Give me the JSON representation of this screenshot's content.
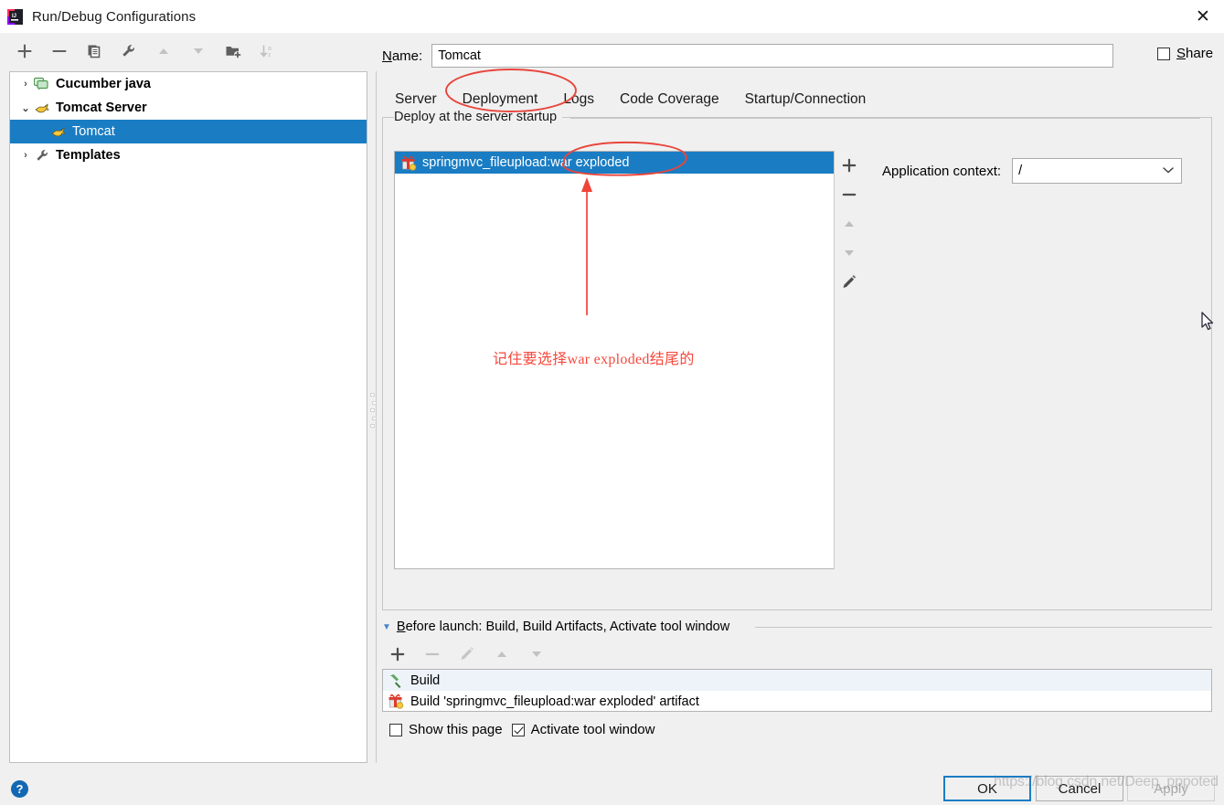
{
  "window": {
    "title": "Run/Debug Configurations",
    "close_label": "✕",
    "app_icon": "intellij-idea-icon"
  },
  "left_toolbar": {
    "buttons": [
      {
        "name": "add-configuration-button",
        "icon": "plus-icon",
        "label": "+",
        "enabled": true
      },
      {
        "name": "remove-configuration-button",
        "icon": "minus-icon",
        "label": "−",
        "enabled": true
      },
      {
        "name": "copy-configuration-button",
        "icon": "copy-icon",
        "label": "",
        "enabled": true
      },
      {
        "name": "edit-templates-button",
        "icon": "wrench-icon",
        "label": "",
        "enabled": true
      },
      {
        "name": "move-up-button",
        "icon": "arrow-up-icon",
        "label": "",
        "enabled": false
      },
      {
        "name": "move-down-button",
        "icon": "arrow-down-icon",
        "label": "",
        "enabled": false
      },
      {
        "name": "create-folder-button",
        "icon": "folder-add-icon",
        "label": "",
        "enabled": true
      },
      {
        "name": "sort-alphabetically-button",
        "icon": "sort-az-icon",
        "label": "",
        "enabled": false
      }
    ]
  },
  "tree": {
    "items": [
      {
        "label": "Cucumber java",
        "icon": "cucumber-icon",
        "twisty": "›",
        "expanded": false,
        "indent": 0,
        "selected": false,
        "bold": true
      },
      {
        "label": "Tomcat Server",
        "icon": "tomcat-icon",
        "twisty": "⌄",
        "expanded": true,
        "indent": 0,
        "selected": false,
        "bold": true
      },
      {
        "label": "Tomcat",
        "icon": "tomcat-icon",
        "twisty": "",
        "expanded": false,
        "indent": 1,
        "selected": true,
        "bold": false
      },
      {
        "label": "Templates",
        "icon": "wrench-icon",
        "twisty": "›",
        "expanded": false,
        "indent": 0,
        "selected": false,
        "bold": true
      }
    ]
  },
  "name_field": {
    "label_prefix": "N",
    "label_rest": "ame:",
    "value": "Tomcat",
    "placeholder": ""
  },
  "share": {
    "label_prefix": "S",
    "label_rest": "hare",
    "checked": false
  },
  "tabs": {
    "items": [
      {
        "label": "Server",
        "active": false
      },
      {
        "label": "Deployment",
        "active": true
      },
      {
        "label": "Logs",
        "active": false
      },
      {
        "label": "Code Coverage",
        "active": false
      },
      {
        "label": "Startup/Connection",
        "active": false
      }
    ],
    "active_underline_color": "#3f7fd0"
  },
  "deployment": {
    "legend": "Deploy at the server startup",
    "items": [
      {
        "label": "springmvc_fileupload:war exploded",
        "icon": "artifact-icon",
        "selected": true
      }
    ],
    "side_buttons": [
      {
        "name": "add-artifact-button",
        "icon": "plus-icon",
        "label": "+",
        "enabled": true
      },
      {
        "name": "remove-artifact-button",
        "icon": "minus-icon",
        "label": "−",
        "enabled": true
      },
      {
        "name": "move-artifact-up-button",
        "icon": "arrow-up-icon",
        "label": "",
        "enabled": false
      },
      {
        "name": "move-artifact-down-button",
        "icon": "arrow-down-icon",
        "label": "",
        "enabled": false
      },
      {
        "name": "edit-artifact-button",
        "icon": "pencil-icon",
        "label": "",
        "enabled": true
      }
    ],
    "application_context": {
      "label": "Application context:",
      "value": "/",
      "chevron": "⌄"
    }
  },
  "before_launch": {
    "triangle": "▼",
    "header_prefix": "B",
    "header_rest": "efore launch: Build, Build Artifacts, Activate tool window",
    "toolbar": [
      {
        "name": "add-task-button",
        "icon": "plus-icon",
        "label": "+",
        "enabled": true
      },
      {
        "name": "remove-task-button",
        "icon": "minus-icon",
        "label": "−",
        "enabled": false
      },
      {
        "name": "edit-task-button",
        "icon": "pencil-icon",
        "label": "",
        "enabled": false
      },
      {
        "name": "task-move-up-button",
        "icon": "arrow-up-icon",
        "label": "",
        "enabled": false
      },
      {
        "name": "task-move-down-button",
        "icon": "arrow-down-icon",
        "label": "",
        "enabled": false
      }
    ],
    "tasks": [
      {
        "label": "Build",
        "icon": "hammer-icon",
        "selected": true
      },
      {
        "label": "Build 'springmvc_fileupload:war exploded' artifact",
        "icon": "artifact-icon",
        "selected": false
      }
    ],
    "show_this_page": {
      "label": "Show this page",
      "checked": false
    },
    "activate_tool_window": {
      "label": "Activate tool window",
      "checked": true
    }
  },
  "footer": {
    "help_label": "?",
    "buttons": [
      {
        "name": "ok-button",
        "label": "OK",
        "style": "primary",
        "enabled": true
      },
      {
        "name": "cancel-button",
        "label": "Cancel",
        "style": "normal",
        "enabled": true
      },
      {
        "name": "apply-button",
        "label": "Apply",
        "style": "disabled",
        "enabled": false
      }
    ]
  },
  "annotations": {
    "note_text": "记住要选择war exploded结尾的",
    "note_color": "#f6483d",
    "ellipse_tab": "Deployment",
    "ellipse_item": "war exploded",
    "arrow": "points-to-deployment-item"
  },
  "watermark": {
    "text": "https://blog.csdn.net/Deep_pppoted"
  }
}
